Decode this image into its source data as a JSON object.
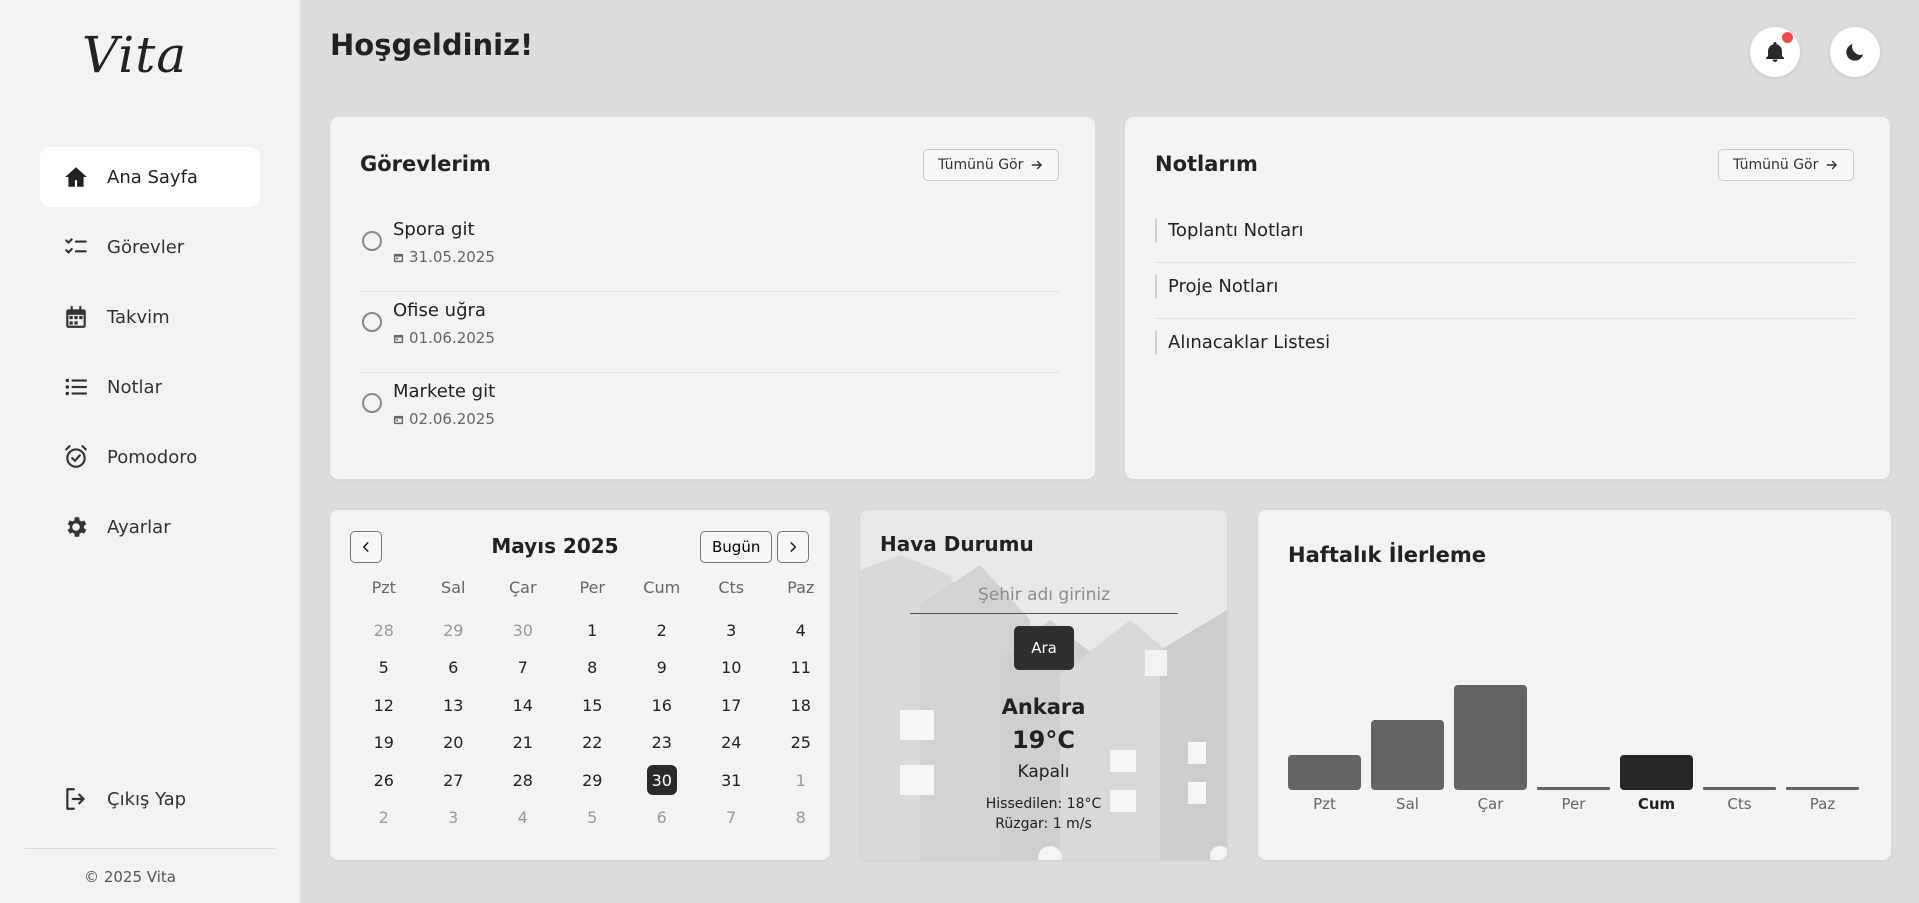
{
  "app": {
    "logo": "Vita"
  },
  "sidebar": {
    "items": [
      {
        "label": "Ana Sayfa",
        "icon": "home-icon",
        "active": true
      },
      {
        "label": "Görevler",
        "icon": "checklist-icon",
        "active": false
      },
      {
        "label": "Takvim",
        "icon": "calendar-icon",
        "active": false
      },
      {
        "label": "Notlar",
        "icon": "list-icon",
        "active": false
      },
      {
        "label": "Pomodoro",
        "icon": "alarm-clock-icon",
        "active": false
      },
      {
        "label": "Ayarlar",
        "icon": "gear-icon",
        "active": false
      }
    ],
    "logout_label": "Çıkış Yap",
    "copyright": "© 2025 Vita"
  },
  "header": {
    "title": "Hoşgeldiniz!",
    "notification_icon": "bell-icon",
    "theme_icon": "moon-icon",
    "notification_dot_color": "#ef4b4b"
  },
  "tasks": {
    "title": "Görevlerim",
    "see_all": "Tümünü Gör",
    "items": [
      {
        "name": "Spora git",
        "date": "31.05.2025"
      },
      {
        "name": "Ofise uğra",
        "date": "01.06.2025"
      },
      {
        "name": "Markete git",
        "date": "02.06.2025"
      }
    ]
  },
  "notes": {
    "title": "Notlarım",
    "see_all": "Tümünü Gör",
    "items": [
      {
        "label": "Toplantı Notları"
      },
      {
        "label": "Proje Notları"
      },
      {
        "label": "Alınacaklar Listesi"
      }
    ]
  },
  "calendar": {
    "month_label": "Mayıs 2025",
    "today_label": "Bugün",
    "weekdays": [
      "Pzt",
      "Sal",
      "Çar",
      "Per",
      "Cum",
      "Cts",
      "Paz"
    ],
    "selected_day": "30",
    "days": [
      {
        "d": "28",
        "muted": true
      },
      {
        "d": "29",
        "muted": true
      },
      {
        "d": "30",
        "muted": true
      },
      {
        "d": "1"
      },
      {
        "d": "2"
      },
      {
        "d": "3"
      },
      {
        "d": "4"
      },
      {
        "d": "5"
      },
      {
        "d": "6"
      },
      {
        "d": "7"
      },
      {
        "d": "8"
      },
      {
        "d": "9"
      },
      {
        "d": "10"
      },
      {
        "d": "11"
      },
      {
        "d": "12"
      },
      {
        "d": "13"
      },
      {
        "d": "14"
      },
      {
        "d": "15"
      },
      {
        "d": "16"
      },
      {
        "d": "17"
      },
      {
        "d": "18"
      },
      {
        "d": "19"
      },
      {
        "d": "20"
      },
      {
        "d": "21"
      },
      {
        "d": "22"
      },
      {
        "d": "23"
      },
      {
        "d": "24"
      },
      {
        "d": "25"
      },
      {
        "d": "26"
      },
      {
        "d": "27"
      },
      {
        "d": "28"
      },
      {
        "d": "29"
      },
      {
        "d": "30",
        "selected": true
      },
      {
        "d": "31"
      },
      {
        "d": "1",
        "muted": true
      },
      {
        "d": "2",
        "muted": true
      },
      {
        "d": "3",
        "muted": true
      },
      {
        "d": "4",
        "muted": true
      },
      {
        "d": "5",
        "muted": true
      },
      {
        "d": "6",
        "muted": true
      },
      {
        "d": "7",
        "muted": true
      },
      {
        "d": "8",
        "muted": true
      }
    ]
  },
  "weather": {
    "title": "Hava Durumu",
    "input_placeholder": "Şehir adı giriniz",
    "search_label": "Ara",
    "city": "Ankara",
    "temperature": "19°C",
    "condition": "Kapalı",
    "feels_like": "Hissedilen: 18°C",
    "wind": "Rüzgar: 1 m/s"
  },
  "weekly": {
    "title": "Haftalık İlerleme"
  },
  "chart_data": {
    "type": "bar",
    "categories": [
      "Pzt",
      "Sal",
      "Çar",
      "Per",
      "Cum",
      "Cts",
      "Paz"
    ],
    "values": [
      1,
      2,
      3,
      0,
      1,
      0,
      0
    ],
    "highlight": "Cum",
    "ylim": [
      0,
      3
    ],
    "colors": {
      "bar": "#646464",
      "highlight": "#262628",
      "empty": "#646464"
    },
    "grid": false
  }
}
